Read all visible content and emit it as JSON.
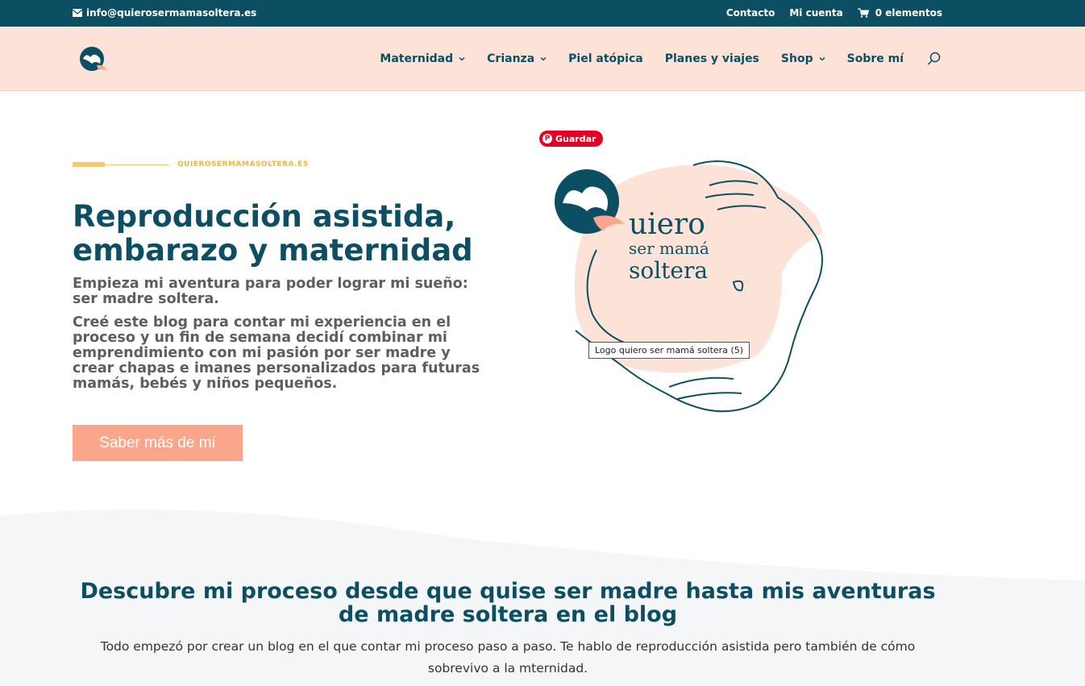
{
  "topbar": {
    "email": "info@quierosermamasoltera.es",
    "contact": "Contacto",
    "account": "Mi cuenta",
    "cart": "0 elementos"
  },
  "nav": {
    "items": [
      {
        "label": "Maternidad",
        "has_dropdown": true
      },
      {
        "label": "Crianza",
        "has_dropdown": true
      },
      {
        "label": "Piel atópica",
        "has_dropdown": false
      },
      {
        "label": "Planes y viajes",
        "has_dropdown": false
      },
      {
        "label": "Shop",
        "has_dropdown": true
      },
      {
        "label": "Sobre mí",
        "has_dropdown": false
      }
    ]
  },
  "hero": {
    "tagline": "QUIEROSERMAMASOLTERA.ES",
    "title": "Reproducción asistida, embarazo y maternidad",
    "subtitle": "Empieza mi aventura para poder lograr mi sueño: ser madre soltera.",
    "description": "Creé este blog para contar mi experiencia en el proceso y un fin de semana decidí combinar mi emprendimiento con mi pasión por ser madre y crear chapas e imanes personalizados para futuras mamás, bebés y niños pequeños.",
    "cta_label": "Saber más de mí"
  },
  "image": {
    "pin_label": "Guardar",
    "logo_text_line1": "uiero",
    "logo_text_line2": "ser mamá",
    "logo_text_line3": "soltera",
    "tooltip": "Logo quiero ser mamá soltera (5)"
  },
  "section": {
    "title": "Descubre mi proceso desde que quise ser madre hasta mis aventuras de madre soltera en el blog",
    "paragraph": "Todo empezó por crear un blog en el que contar mi proceso paso a paso. Te hablo de reproducción asistida pero también de cómo sobrevivo a la mternidad."
  },
  "colors": {
    "primary": "#0c4f63",
    "header_bg": "#fde3d7",
    "accent": "#f9a68d",
    "tagline": "#f0b73f"
  }
}
